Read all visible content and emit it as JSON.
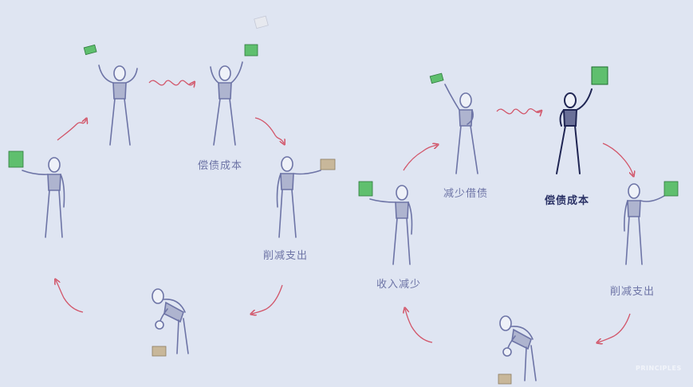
{
  "labels": {
    "repay_left": "偿债成本",
    "cut_left": "削减支出",
    "less_borrow": "减少借债",
    "repay_right": "偿债成本",
    "income_down": "收入减少",
    "cut_right": "削减支出"
  },
  "logo_text": "PRINCIPLES",
  "colors": {
    "background": "#dfe5f2",
    "figure_light": "#6d74a6",
    "figure_dark": "#1f2553",
    "arrow": "#d2566a",
    "money": "#5fbf6e",
    "box": "#c8b79a"
  }
}
